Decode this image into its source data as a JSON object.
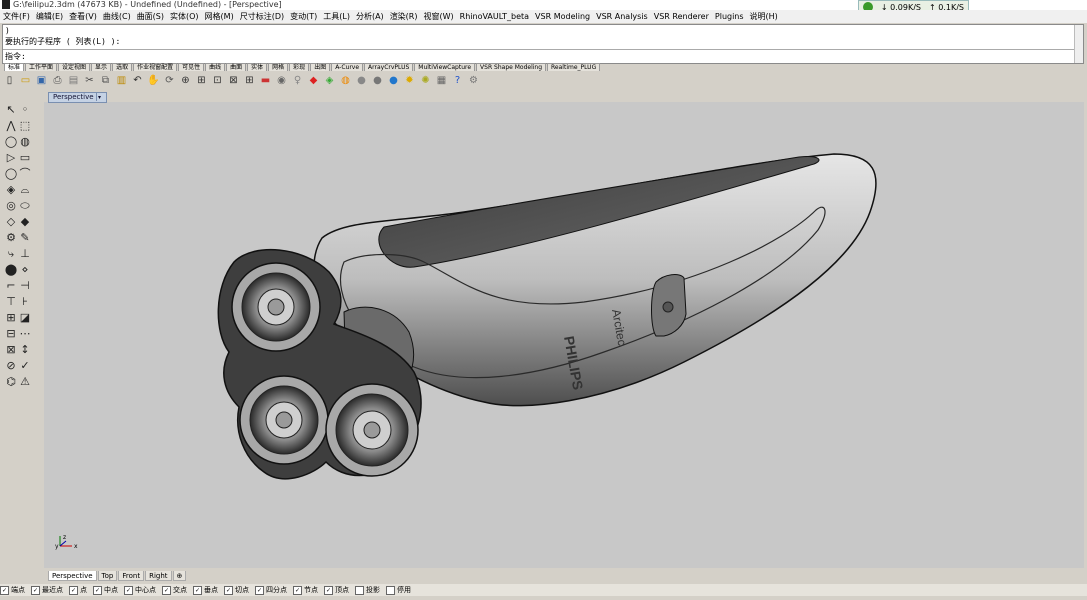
{
  "window": {
    "title": "G:\\feilipu2.3dm (47673 KB) - Undefined (Undefined) - [Perspective]"
  },
  "netmon": {
    "down": "0.09K/S",
    "up": "0.1K/S"
  },
  "menu": [
    "文件(F)",
    "编辑(E)",
    "查看(V)",
    "曲线(C)",
    "曲面(S)",
    "实体(O)",
    "网格(M)",
    "尺寸标注(D)",
    "变动(T)",
    "工具(L)",
    "分析(A)",
    "渲染(R)",
    "视窗(W)",
    "RhinoVAULT_beta",
    "VSR Modeling",
    "VSR Analysis",
    "VSR Renderer",
    "Plugins",
    "说明(H)"
  ],
  "command": {
    "line1": ")",
    "line2": "要执行的子程序 ( 列表(L) ):",
    "prompt": "指令:"
  },
  "toolbar_tabs": [
    "标准",
    "工作平面",
    "设定视图",
    "显示",
    "选取",
    "作业视窗配置",
    "可见性",
    "曲线",
    "曲面",
    "实体",
    "网格",
    "彩现",
    "出图",
    "A-Curve",
    "ArrayCrvPLUS",
    "MultiViewCapture",
    "VSR Shape Modeling",
    "Realtime_PLUG"
  ],
  "toolbar_active_tab": "标准",
  "toolbar_icons": [
    "new-icon",
    "open-icon",
    "save-icon",
    "print-icon",
    "import-icon",
    "cut-icon",
    "copy-icon",
    "paste-icon",
    "undo-icon",
    "pan-icon",
    "rotate-view-icon",
    "zoom-icon",
    "zoom-window-icon",
    "zoom-extents-icon",
    "zoom-selected-icon",
    "four-views-icon",
    "car-icon",
    "camera-icon",
    "light-icon",
    "material-icon",
    "render-icon",
    "color-wheel-icon",
    "sphere-shaded-icon",
    "sphere-rendered-icon",
    "sphere-blue-icon",
    "sun-icon",
    "gear-icon",
    "options-icon",
    "help-icon",
    "settings-icon"
  ],
  "viewport": {
    "label": "Perspective",
    "background": "#c8c8c8",
    "brand_text": "PHILIPS",
    "model_text": "Arcitec"
  },
  "axis": {
    "x": "x",
    "y": "y",
    "z": "z"
  },
  "view_tabs": [
    "Perspective",
    "Top",
    "Front",
    "Right",
    "⊕"
  ],
  "active_view": "Perspective",
  "osnaps": [
    {
      "label": "端点",
      "checked": true
    },
    {
      "label": "最近点",
      "checked": true
    },
    {
      "label": "点",
      "checked": true
    },
    {
      "label": "中点",
      "checked": true
    },
    {
      "label": "中心点",
      "checked": true
    },
    {
      "label": "交点",
      "checked": true
    },
    {
      "label": "垂点",
      "checked": true
    },
    {
      "label": "切点",
      "checked": true
    },
    {
      "label": "四分点",
      "checked": true
    },
    {
      "label": "节点",
      "checked": true
    },
    {
      "label": "顶点",
      "checked": true
    },
    {
      "label": "投影",
      "checked": false
    },
    {
      "label": "停用",
      "checked": false
    }
  ]
}
